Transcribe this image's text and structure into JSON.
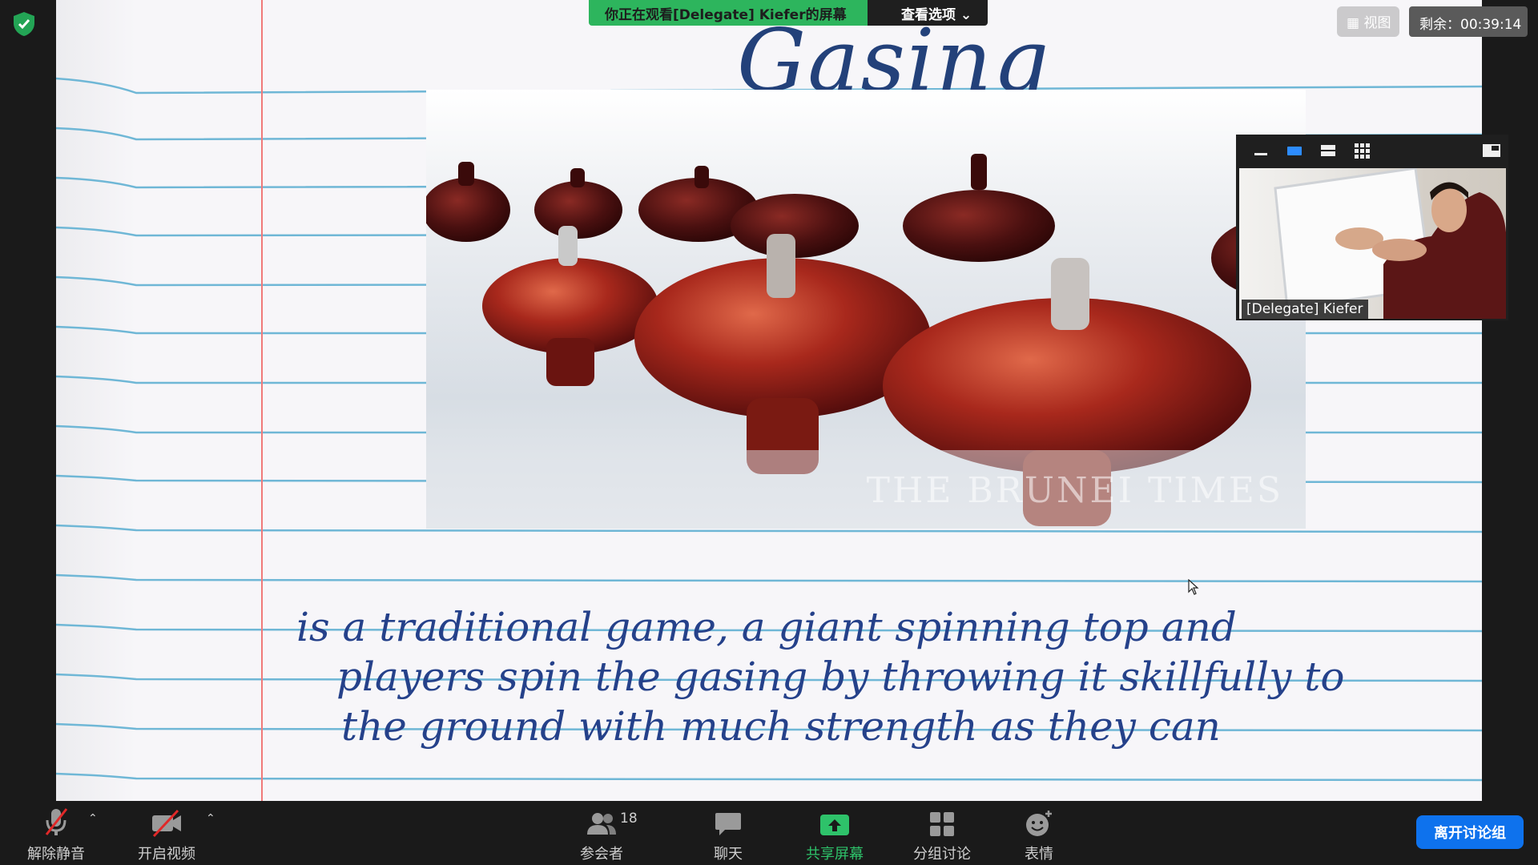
{
  "banner": {
    "viewing_label": "你正在观看[Delegate]  Kiefer的屏幕",
    "options_label": "查看选项"
  },
  "top_right": {
    "view_label": "视图",
    "timer_label": "剩余：00:39:14"
  },
  "slide": {
    "title": "Gasing",
    "photo_watermark": "THE BRUNEI TIMES",
    "caption_lines": [
      "is a  traditional game, a giant spinning top and",
      "players spin the gasing by throwing it skillfully to",
      "the ground with much strength as they can"
    ]
  },
  "video": {
    "participant_name": "[Delegate] Kiefer",
    "toolbar_icons": [
      "minimize-icon",
      "speaker-view-icon",
      "strip-view-icon",
      "gallery-view-icon",
      "popout-icon"
    ]
  },
  "toolbar": {
    "unmute_label": "解除静音",
    "start_video_label": "开启视频",
    "participants_label": "参会者",
    "participants_count": "18",
    "chat_label": "聊天",
    "share_screen_label": "共享屏幕",
    "breakout_label": "分组讨论",
    "reactions_label": "表情",
    "leave_label": "离开讨论组"
  },
  "colors": {
    "share_green": "#2db55d",
    "leave_blue": "#0e72ed",
    "caption_ink": "#25418a",
    "margin_red": "#f07a7a",
    "ruled_line_blue": "#6fb7d6"
  }
}
